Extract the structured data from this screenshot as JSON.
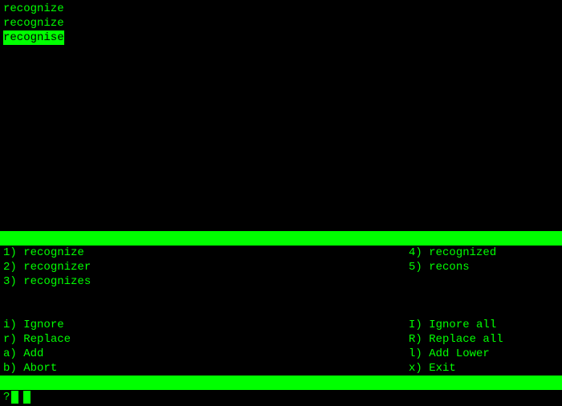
{
  "document": {
    "lines": [
      {
        "text": "recognize",
        "highlighted": false
      },
      {
        "text": "recognize",
        "highlighted": false
      },
      {
        "text": "recognise",
        "highlighted": true
      }
    ]
  },
  "suggestions": {
    "left": [
      {
        "key": "1",
        "word": "recognize"
      },
      {
        "key": "2",
        "word": "recognizer"
      },
      {
        "key": "3",
        "word": "recognizes"
      }
    ],
    "right": [
      {
        "key": "4",
        "word": "recognized"
      },
      {
        "key": "5",
        "word": "recons"
      }
    ]
  },
  "commands": {
    "left": [
      {
        "key": "i",
        "label": "Ignore"
      },
      {
        "key": "r",
        "label": "Replace"
      },
      {
        "key": "a",
        "label": "Add"
      },
      {
        "key": "b",
        "label": "Abort"
      }
    ],
    "right": [
      {
        "key": "I",
        "label": "Ignore all"
      },
      {
        "key": "R",
        "label": "Replace all"
      },
      {
        "key": "l",
        "label": "Add Lower"
      },
      {
        "key": "x",
        "label": "Exit"
      }
    ]
  },
  "prompt": {
    "char": "?"
  }
}
